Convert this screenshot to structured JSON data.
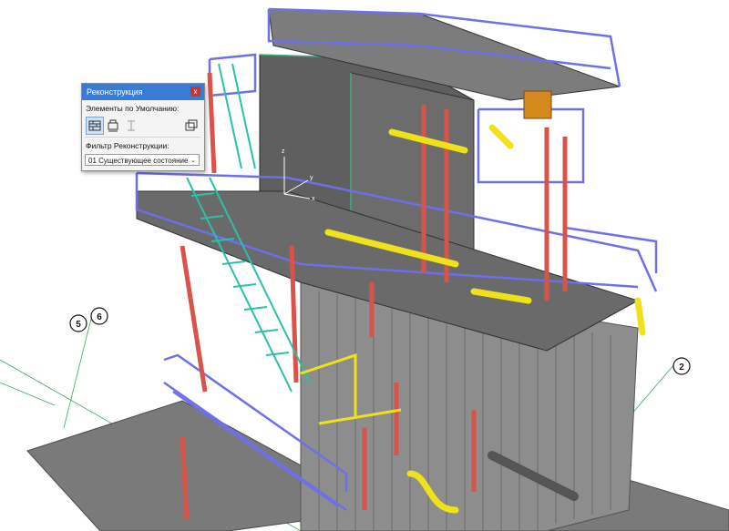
{
  "palette": {
    "title": "Реконструкция",
    "close_glyph": "x",
    "section_label": "Элементы по Умолчанию:",
    "filter_label": "Фильтр Реконструкции:",
    "filter_value": "01 Существующее состояние",
    "buttons": [
      {
        "icon": "existing-wall-icon",
        "active": true
      },
      {
        "icon": "demolish-icon",
        "active": false
      },
      {
        "icon": "new-element-icon",
        "active": false
      },
      {
        "icon": "show-all-icon",
        "active": false
      }
    ]
  },
  "axis_gizmo": {
    "x": "x",
    "y": "y",
    "z": "z"
  },
  "grid_markers": [
    {
      "label": "5"
    },
    {
      "label": "6"
    },
    {
      "label": "2"
    }
  ],
  "colors": {
    "railing": "#6f6fe8",
    "column_red": "#d9534a",
    "stair_teal": "#2cc0a8",
    "pipe_yellow": "#f0e21a",
    "structure_gray": "#6b6b6b",
    "titlebar": "#3c7bd3"
  }
}
